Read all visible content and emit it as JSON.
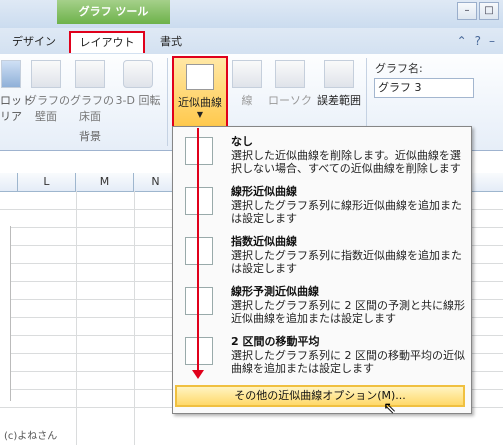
{
  "context_tab": "グラフ ツール",
  "tabs": {
    "design": "デザイン",
    "layout": "レイアウト",
    "format": "書式"
  },
  "ribbon": {
    "buttons_left": [
      {
        "label": "ロット\nリア"
      },
      {
        "label": "グラフの\n壁面"
      },
      {
        "label": "グラフの\n床面"
      },
      {
        "label": "3-D 回転"
      }
    ],
    "group_background": "背景",
    "trendline": "近似曲線",
    "line": "線",
    "updown": "ローソク",
    "errorbar": "誤差範囲",
    "chart_name_label": "グラフ名:",
    "chart_name_value": "グラフ 3"
  },
  "columns": [
    "L",
    "M",
    "N"
  ],
  "menu": {
    "items": [
      {
        "title": "なし",
        "desc": "選択した近似曲線を削除します。近似曲線を選択しない場合、すべての近似曲線を削除します"
      },
      {
        "title": "線形近似曲線",
        "desc": "選択したグラフ系列に線形近似曲線を追加または設定します"
      },
      {
        "title": "指数近似曲線",
        "desc": "選択したグラフ系列に指数近似曲線を追加または設定します"
      },
      {
        "title": "線形予測近似曲線",
        "desc": "選択したグラフ系列に 2 区間の予測と共に線形近似曲線を追加または設定します"
      },
      {
        "title": "2 区間の移動平均",
        "desc": "選択したグラフ系列に 2 区間の移動平均の近似曲線を追加または設定します"
      }
    ],
    "more_options": "その他の近似曲線オプション(M)..."
  },
  "copyright": "(c)よねさん",
  "colors": {
    "highlight": "#e0001b",
    "context": "#6db24a"
  }
}
